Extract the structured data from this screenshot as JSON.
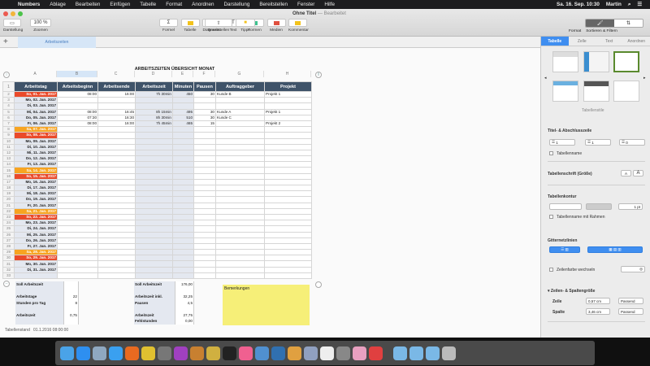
{
  "menubar": {
    "items": [
      "Numbers",
      "Ablage",
      "Bearbeiten",
      "Einfügen",
      "Tabelle",
      "Format",
      "Anordnen",
      "Darstellung",
      "Bereitstellen",
      "Fenster",
      "Hilfe"
    ],
    "clock": "Sa. 16. Sep.  10:30",
    "user": "Martin"
  },
  "window": {
    "title": "Ohne Titel",
    "subtitle": "— Bearbeitet"
  },
  "toolbar": {
    "left": [
      {
        "icon": "view-icon",
        "label": "Darstellung",
        "value": "▭"
      },
      {
        "icon": "zoom-icon",
        "label": "Zoomen",
        "value": "100 %"
      }
    ],
    "center": [
      {
        "icon": "format-icon",
        "label": "Formel",
        "value": "Σ"
      },
      {
        "icon": "table-icon",
        "label": "Tabelle",
        "color": "#f2c21b"
      },
      {
        "icon": "chart-icon",
        "label": "Diagramm",
        "color": "#3f8ef0"
      },
      {
        "icon": "text-icon",
        "label": "Text",
        "value": "T"
      },
      {
        "icon": "shape-icon",
        "label": "Formen",
        "color": "#3ec28f"
      },
      {
        "icon": "media-icon",
        "label": "Medien",
        "color": "#e0503f"
      },
      {
        "icon": "comment-icon",
        "label": "Kommentar",
        "color": "#f2c21b"
      }
    ],
    "share": {
      "label": "Bereitstellen",
      "value": "⇧"
    },
    "tips": {
      "label": "Tipps",
      "value": "💡"
    },
    "format": "Format",
    "sort": "Sortieren & Filtern"
  },
  "sheet": {
    "tab": "Arbeitszeiten"
  },
  "table": {
    "title": "ARBEITSZEITEN ÜBERSICHT MONAT",
    "column_letters": [
      "A",
      "B",
      "C",
      "D",
      "E",
      "F",
      "G",
      "H"
    ],
    "headers": [
      "Arbeitstag",
      "Arbeitsbeginn",
      "Arbeitsende",
      "Arbeitszeit",
      "Minuten",
      "Pausen",
      "Auftraggeber",
      "Projekt"
    ],
    "rows": [
      [
        "So, 01. Jan. 2017",
        "08:00",
        "16:00",
        "7h 30min",
        "450",
        "30",
        "Kunde B",
        "Projekt 1",
        "sun"
      ],
      [
        "Mo, 02. Jan. 2017",
        "",
        "",
        "",
        "",
        "",
        "",
        "",
        ""
      ],
      [
        "Di, 03. Jan. 2017",
        "",
        "",
        "",
        "",
        "",
        "",
        "",
        ""
      ],
      [
        "Mi, 04. Jan. 2017",
        "08:00",
        "16:45",
        "8h 15min",
        "495",
        "30",
        "Kunde A",
        "Projekt 1",
        ""
      ],
      [
        "Do, 05. Jan. 2017",
        "07:30",
        "16:30",
        "8h 30min",
        "510",
        "30",
        "Kunde C",
        "",
        ""
      ],
      [
        "Fr, 06. Jan. 2017",
        "08:00",
        "16:00",
        "7h 45min",
        "465",
        "15",
        "",
        "Projekt 2",
        ""
      ],
      [
        "Sa, 07. Jan. 2017",
        "",
        "",
        "",
        "",
        "",
        "",
        "",
        "sat"
      ],
      [
        "So, 08. Jan. 2017",
        "",
        "",
        "",
        "",
        "",
        "",
        "",
        "sun"
      ],
      [
        "Mo, 09. Jan. 2017",
        "",
        "",
        "",
        "",
        "",
        "",
        "",
        ""
      ],
      [
        "Di, 10. Jan. 2017",
        "",
        "",
        "",
        "",
        "",
        "",
        "",
        ""
      ],
      [
        "Mi, 11. Jan. 2017",
        "",
        "",
        "",
        "",
        "",
        "",
        "",
        ""
      ],
      [
        "Do, 12. Jan. 2017",
        "",
        "",
        "",
        "",
        "",
        "",
        "",
        ""
      ],
      [
        "Fr, 13. Jan. 2017",
        "",
        "",
        "",
        "",
        "",
        "",
        "",
        ""
      ],
      [
        "Sa, 14. Jan. 2017",
        "",
        "",
        "",
        "",
        "",
        "",
        "",
        "sat"
      ],
      [
        "So, 15. Jan. 2017",
        "",
        "",
        "",
        "",
        "",
        "",
        "",
        "sun"
      ],
      [
        "Mo, 16. Jan. 2017",
        "",
        "",
        "",
        "",
        "",
        "",
        "",
        ""
      ],
      [
        "Di, 17. Jan. 2017",
        "",
        "",
        "",
        "",
        "",
        "",
        "",
        ""
      ],
      [
        "Mi, 18. Jan. 2017",
        "",
        "",
        "",
        "",
        "",
        "",
        "",
        ""
      ],
      [
        "Do, 19. Jan. 2017",
        "",
        "",
        "",
        "",
        "",
        "",
        "",
        ""
      ],
      [
        "Fr, 20. Jan. 2017",
        "",
        "",
        "",
        "",
        "",
        "",
        "",
        ""
      ],
      [
        "Sa, 21. Jan. 2017",
        "",
        "",
        "",
        "",
        "",
        "",
        "",
        "sat"
      ],
      [
        "So, 22. Jan. 2017",
        "",
        "",
        "",
        "",
        "",
        "",
        "",
        "sun"
      ],
      [
        "Mo, 23. Jan. 2017",
        "",
        "",
        "",
        "",
        "",
        "",
        "",
        ""
      ],
      [
        "Di, 24. Jan. 2017",
        "",
        "",
        "",
        "",
        "",
        "",
        "",
        ""
      ],
      [
        "Mi, 25. Jan. 2017",
        "",
        "",
        "",
        "",
        "",
        "",
        "",
        ""
      ],
      [
        "Do, 26. Jan. 2017",
        "",
        "",
        "",
        "",
        "",
        "",
        "",
        ""
      ],
      [
        "Fr, 27. Jan. 2017",
        "",
        "",
        "",
        "",
        "",
        "",
        "",
        ""
      ],
      [
        "Sa, 28. Jan. 2017",
        "",
        "",
        "",
        "",
        "",
        "",
        "",
        "sat"
      ],
      [
        "So, 29. Jan. 2017",
        "",
        "",
        "",
        "",
        "",
        "",
        "",
        "sun"
      ],
      [
        "Mo, 30. Jan. 2017",
        "",
        "",
        "",
        "",
        "",
        "",
        "",
        ""
      ],
      [
        "Di, 31. Jan. 2017",
        "",
        "",
        "",
        "",
        "",
        "",
        "",
        ""
      ],
      [
        "",
        "",
        "",
        "",
        "",
        "",
        "",
        "",
        ""
      ]
    ]
  },
  "summary_left": [
    [
      "Soll Arbeitszeit",
      ""
    ],
    [
      "",
      ""
    ],
    [
      "Arbeitstage",
      "22"
    ],
    [
      "Stunden pro Tag",
      "8"
    ],
    [
      "",
      ""
    ],
    [
      "Arbeitszeit",
      "0,75"
    ],
    [
      "",
      ""
    ]
  ],
  "summary_right": [
    [
      "Soll Arbeitszeit",
      "176,00"
    ],
    [
      "",
      ""
    ],
    [
      "Arbeitszeit inkl.",
      "32,25"
    ],
    [
      "Pausen",
      "4,5"
    ],
    [
      "",
      ""
    ],
    [
      "Arbeitszeit",
      "27,75"
    ],
    [
      "Fehlstunden",
      "0,00"
    ]
  ],
  "note": {
    "title": "Bemerkungen"
  },
  "footer": {
    "label": "Tabellenstand",
    "value": "01.1.2016 08:00:00"
  },
  "sidebar": {
    "tabs": [
      "Tabelle",
      "Zelle",
      "Text",
      "Anordnen"
    ],
    "styles_caption": "Tabellenstile",
    "header_footer": {
      "title": "Titel- & Abschlusszeile",
      "values": [
        "1",
        "1",
        "0"
      ],
      "table_name": "Tabellenname"
    },
    "font_size": {
      "label": "Tabellenschrift (Größe)",
      "smaller": "A",
      "larger": "A"
    },
    "outline": {
      "title": "Tabellenkontur",
      "width": "1 pt",
      "frame_label": "Tabellenname mit Rahmen"
    },
    "gridlines": {
      "title": "Gitternetzlinien"
    },
    "alternate": {
      "label": "Zeilenfarbe wechseln"
    },
    "size": {
      "title": "Zeilen- & Spaltengröße",
      "row_label": "Zeile",
      "row_value": "0,57 cm",
      "col_label": "Spalte",
      "col_value": "3,46 cm",
      "fit": "Passend"
    }
  },
  "dock": [
    "Finder",
    "App Store",
    "Vorschau",
    "Safari",
    "Firefox",
    "Chrome",
    "Automator",
    "Alfred",
    "Paket",
    "Transmit",
    "Terminal",
    "iTunes",
    "Kamera",
    "Xcode",
    "Pages",
    "Fotos Import",
    "TextEdit",
    "Rechner",
    "Fotos",
    "Numbers",
    "Programme",
    "Dokumente",
    "Downloads",
    "Papierkorb"
  ],
  "dock_colors": [
    "#4aa3e8",
    "#2e8ff0",
    "#8fa8c0",
    "#3aa0f0",
    "#e86a20",
    "#e0c030",
    "#777",
    "#a040c0",
    "#c88030",
    "#d0b040",
    "#222",
    "#f06090",
    "#5090d0",
    "#3070b0",
    "#e0a040",
    "#90a0c0",
    "#eee",
    "#888",
    "#e8a0c0",
    "#e04040",
    "#7ab8e6",
    "#7ab8e6",
    "#7ab8e6",
    "#bbb"
  ],
  "colors": {
    "accent": "#3f8ef0",
    "header": "#3f5369",
    "sunday": "#ea4a2a",
    "saturday": "#f7a421",
    "note": "#f6ef78"
  }
}
